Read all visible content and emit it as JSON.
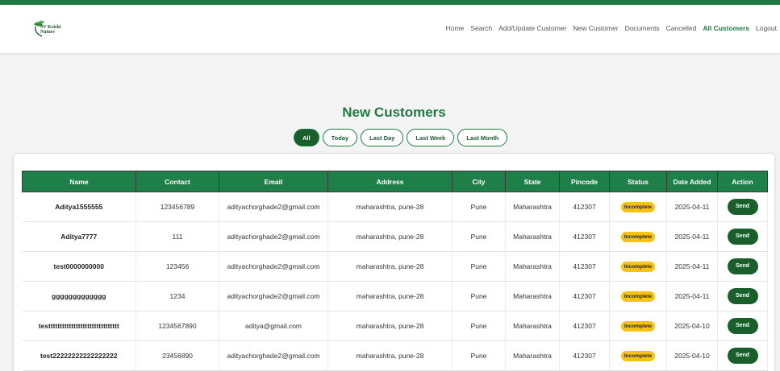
{
  "brand": {
    "logo_text_line1": "SV Krishi",
    "logo_text_line2": "Nature",
    "accent": "#1e7a43"
  },
  "nav": [
    "Home",
    "Search",
    "Add/Update Customer",
    "New Customer",
    "Documents",
    "Cancelled",
    "All Customers",
    "Logout"
  ],
  "nav_active": "All Customers",
  "page_title": "New Customers",
  "filters": [
    "All",
    "Today",
    "Last Day",
    "Last Week",
    "Last Month"
  ],
  "filter_active": "All",
  "table": {
    "headers": [
      "Name",
      "Contact",
      "Email",
      "Address",
      "City",
      "State",
      "Pincode",
      "Status",
      "Date Added",
      "Action"
    ],
    "rows": [
      [
        "Aditya1555555",
        "123456789",
        "adityachorghade2@gmail.com",
        "maharashtra, pune-28",
        "Pune",
        "Maharashtra",
        "412307",
        "Incomplete",
        "2025-04-11",
        "Send"
      ],
      [
        "Aditya7777",
        "111",
        "adityachorghade2@gmail.com",
        "maharashtra, pune-28",
        "Pune",
        "Maharashtra",
        "412307",
        "Incomplete",
        "2025-04-11",
        "Send"
      ],
      [
        "test0000000000",
        "123456",
        "adityachorghade2@gmail.com",
        "maharashtra, pune-28",
        "Pune",
        "Maharashtra",
        "412307",
        "Incomplete",
        "2025-04-11",
        "Send"
      ],
      [
        "ggggggggggggg",
        "1234",
        "adityachorghade2@gmail.com",
        "maharashtra, pune-28",
        "Pune",
        "Maharashtra",
        "412307",
        "Incomplete",
        "2025-04-11",
        "Send"
      ],
      [
        "testtttttttttttttttttttttttttttttt",
        "1234567890",
        "aditya@gmail.com",
        "maharashtra, pune-28",
        "Pune",
        "Maharashtra",
        "412307",
        "Incomplete",
        "2025-04-10",
        "Send"
      ],
      [
        "test22222222222222222",
        "23456890",
        "adityachorghade2@gmail.com",
        "maharashtra, pune-28",
        "Pune",
        "Maharashtra",
        "412307",
        "Incomplete",
        "2025-04-10",
        "Send"
      ]
    ]
  },
  "colors": {
    "header_bg": "#1e8048",
    "button_bg": "#1a5e2c",
    "badge_bg": "#f7c313"
  }
}
